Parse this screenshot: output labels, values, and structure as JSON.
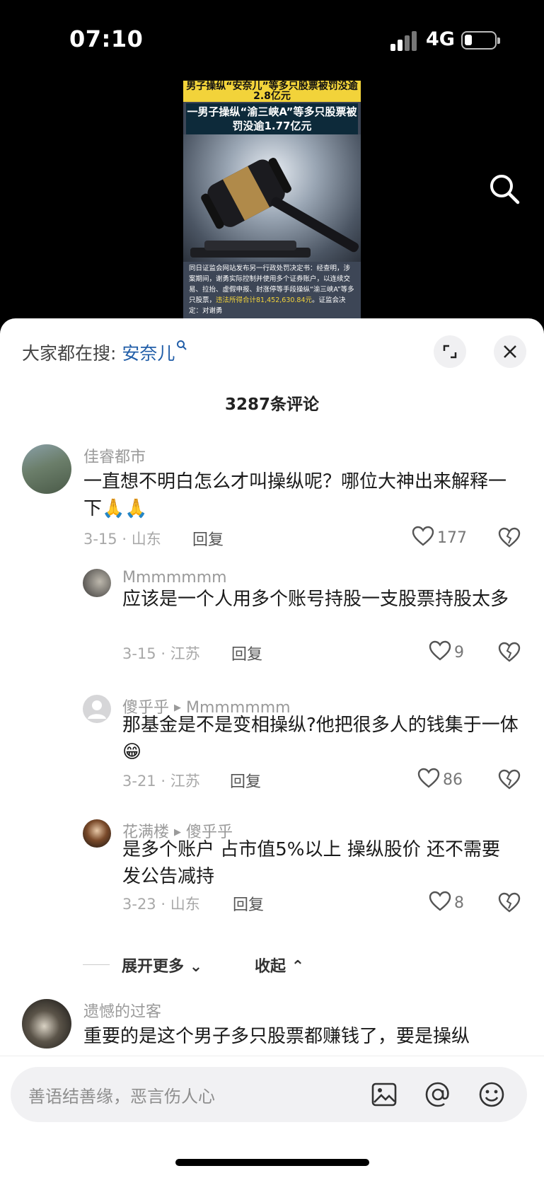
{
  "status_bar": {
    "time": "07:10",
    "network": "4G"
  },
  "video": {
    "headline_top": "男子操纵“安奈儿”等多只股票被罚没逾2.8亿元",
    "headline_main": "一男子操纵“渝三峡A”等多只股票被罚没逾1.77亿元",
    "body_text": "同日证监会网站发布另一行政处罚决定书：经查明，涉案期间，谢勇实际控制并使用多个证券账户，以连续交易、拉抬、虚假申报、封涨停等手段操纵“渝三峡A”等多只股票，",
    "body_highlight": "违法所得合计81,452,630.84元",
    "body_tail": "。证监会决定：对谢勇"
  },
  "sheet": {
    "trending_label": "大家都在搜:",
    "trending_keyword": "安奈儿",
    "comment_count": "3287条评论",
    "expand_more": "展开更多",
    "collapse": "收起"
  },
  "comments": [
    {
      "author": "佳睿都市",
      "text": "一直想不明白怎么才叫操纵呢？哪位大神出来解释一下",
      "emoji": "🙏🙏",
      "date": "3-15",
      "location": "山东",
      "reply": "回复",
      "likes": "177"
    },
    {
      "author": "Mmmmmmm",
      "text": "应该是一个人用多个账号持股一支股票持股太多",
      "date": "3-15",
      "location": "江苏",
      "reply": "回复",
      "likes": "9"
    },
    {
      "author": "傻乎乎",
      "reply_to": "Mmmmmmm",
      "text": "那基金是不是变相操纵?他把很多人的钱集于一体",
      "emoji": "😁",
      "date": "3-21",
      "location": "江苏",
      "reply": "回复",
      "likes": "86"
    },
    {
      "author": "花满楼",
      "reply_to": "傻乎乎",
      "text": "是多个账户 占市值5%以上  操纵股价 还不需要发公告减持",
      "date": "3-23",
      "location": "山东",
      "reply": "回复",
      "likes": "8"
    },
    {
      "author": "遗憾的过客",
      "text": "重要的是这个男子多只股票都赚钱了，要是操纵"
    }
  ],
  "input": {
    "placeholder": "善语结善缘，恶言伤人心"
  },
  "icons": [
    "search-icon",
    "expand-icon",
    "close-icon",
    "heart-icon",
    "dislike-heart-icon",
    "image-icon",
    "at-icon",
    "emoji-icon"
  ]
}
